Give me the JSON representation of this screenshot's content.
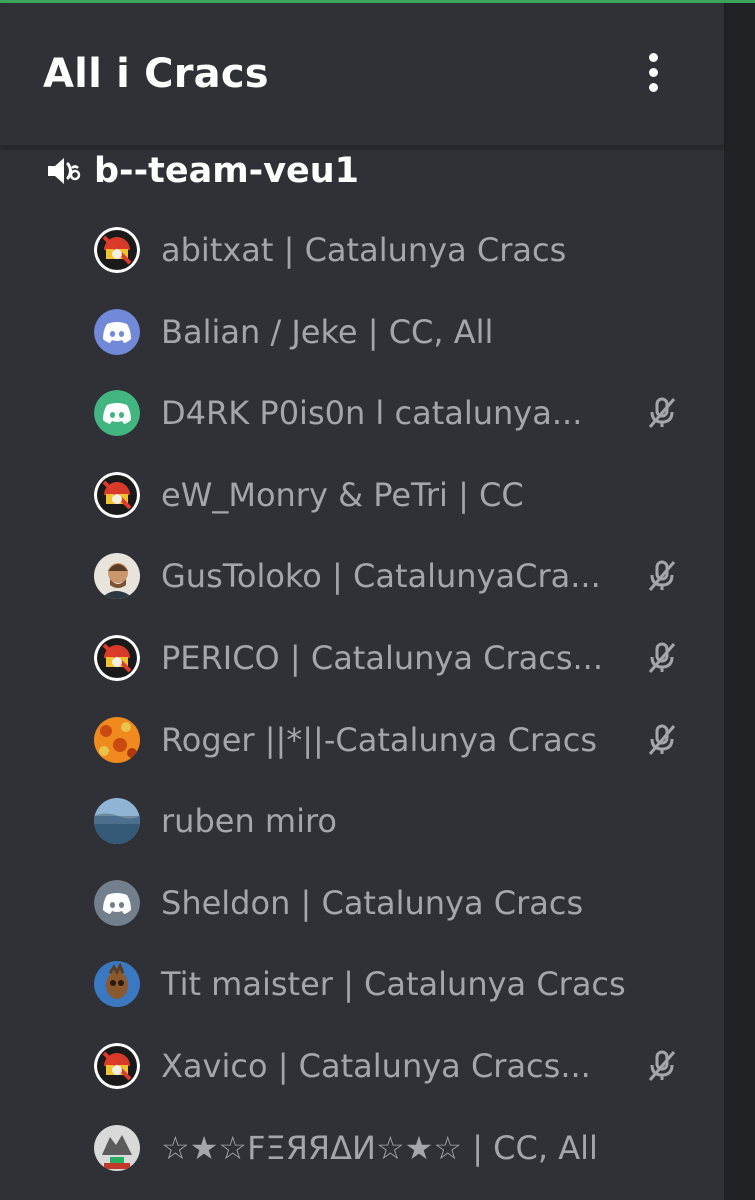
{
  "server": {
    "name": "All i Cracs"
  },
  "channel": {
    "name": "b--team-veu1",
    "icon": "voice-speaker-icon"
  },
  "members": [
    {
      "name": "abitxat | Catalunya Cracs",
      "avatar": "crest",
      "muted": false
    },
    {
      "name": "Balian / Jeke | CC, All",
      "avatar": "discord-blurple",
      "muted": false
    },
    {
      "name": "D4RK P0is0n l catalunya...",
      "avatar": "discord-green",
      "muted": true
    },
    {
      "name": "eW_Monry & PeTri | CC",
      "avatar": "crest",
      "muted": false
    },
    {
      "name": "GusToloko | CatalunyaCra...",
      "avatar": "photo-face",
      "muted": true
    },
    {
      "name": "PERICO | Catalunya Cracs...",
      "avatar": "crest",
      "muted": true
    },
    {
      "name": "Roger ||*||-Catalunya Cracs",
      "avatar": "orange-pattern",
      "muted": true
    },
    {
      "name": "ruben miro",
      "avatar": "photo-landscape",
      "muted": false
    },
    {
      "name": "Sheldon | Catalunya Cracs",
      "avatar": "discord-grey",
      "muted": false
    },
    {
      "name": "Tit maister  | Catalunya Cracs",
      "avatar": "photo-groot",
      "muted": false
    },
    {
      "name": "Xavico | Catalunya Cracs...",
      "avatar": "crest",
      "muted": true
    },
    {
      "name": "☆★☆FΞЯЯΔИ☆★☆ | CC, All",
      "avatar": "photo-wolf",
      "muted": false
    }
  ],
  "colors": {
    "background": "#2f3136",
    "text_primary": "#ffffff",
    "text_member": "#a3a6aa",
    "discord_blurple": "#7289da",
    "discord_green": "#43b581",
    "discord_grey": "#747f8d",
    "accent_line": "#3ba55d"
  }
}
